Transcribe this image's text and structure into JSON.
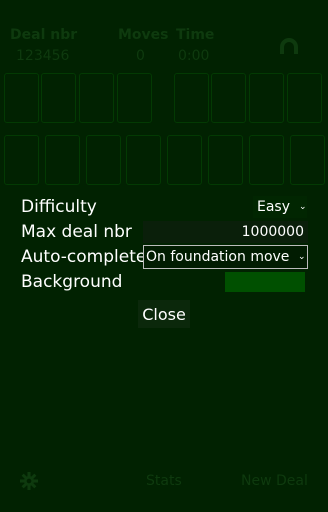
{
  "header": {
    "deal_label": "Deal nbr",
    "deal_value": "123456",
    "moves_label": "Moves",
    "moves_value": "0",
    "time_label": "Time",
    "time_value": "0:00"
  },
  "settings": {
    "difficulty_label": "Difficulty",
    "difficulty_value": "Easy",
    "max_deal_label": "Max deal nbr",
    "max_deal_value": "1000000",
    "autocomplete_label": "Auto-complete",
    "autocomplete_value": "On foundation move",
    "background_label": "Background",
    "background_color": "#005000",
    "close_label": "Close"
  },
  "footer": {
    "stats_label": "Stats",
    "new_deal_label": "New Deal"
  },
  "icons": {
    "undo": "undo-icon",
    "settings": "gear-icon"
  }
}
